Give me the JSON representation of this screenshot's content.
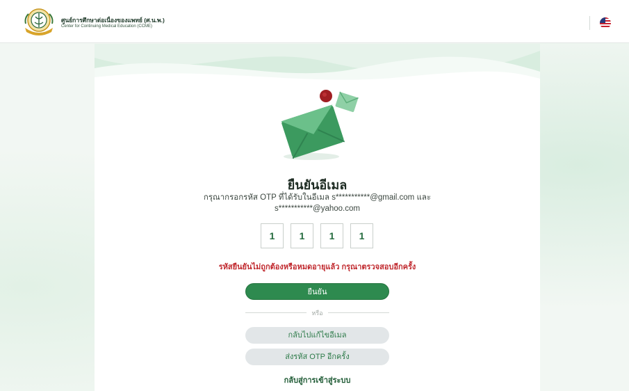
{
  "header": {
    "org_name_th": "ศูนย์การศึกษาต่อเนื่องของแพทย์ (ศ.น.พ.)",
    "org_name_en": "Center for Continuing Medical Education (CCME)",
    "language_flag": "us-flag-icon"
  },
  "verify": {
    "title": "ยืนยันอีเมล",
    "description_line1": "กรุณากรอกรหัส OTP ที่ได้รับในอีเมล s***********@gmail.com และ",
    "description_line2": "s***********@yahoo.com",
    "otp_digits": [
      "1",
      "1",
      "1",
      "1"
    ],
    "error_message": "รหัสยืนยันไม่ถูกต้องหรือหมดอายุแล้ว กรุณาตรวจสอบอีกครั้ง",
    "confirm_label": "ยืนยัน",
    "or_label": "หรือ",
    "edit_email_label": "กลับไปแก้ไขอีเมล",
    "resend_otp_label": "ส่งรหัส OTP อีกครั้ง",
    "back_to_login_label": "กลับสู่การเข้าสู่ระบบ"
  },
  "colors": {
    "primary": "#2e8a4f",
    "error": "#c0282d",
    "secondary_button": "#e2e6e8"
  }
}
